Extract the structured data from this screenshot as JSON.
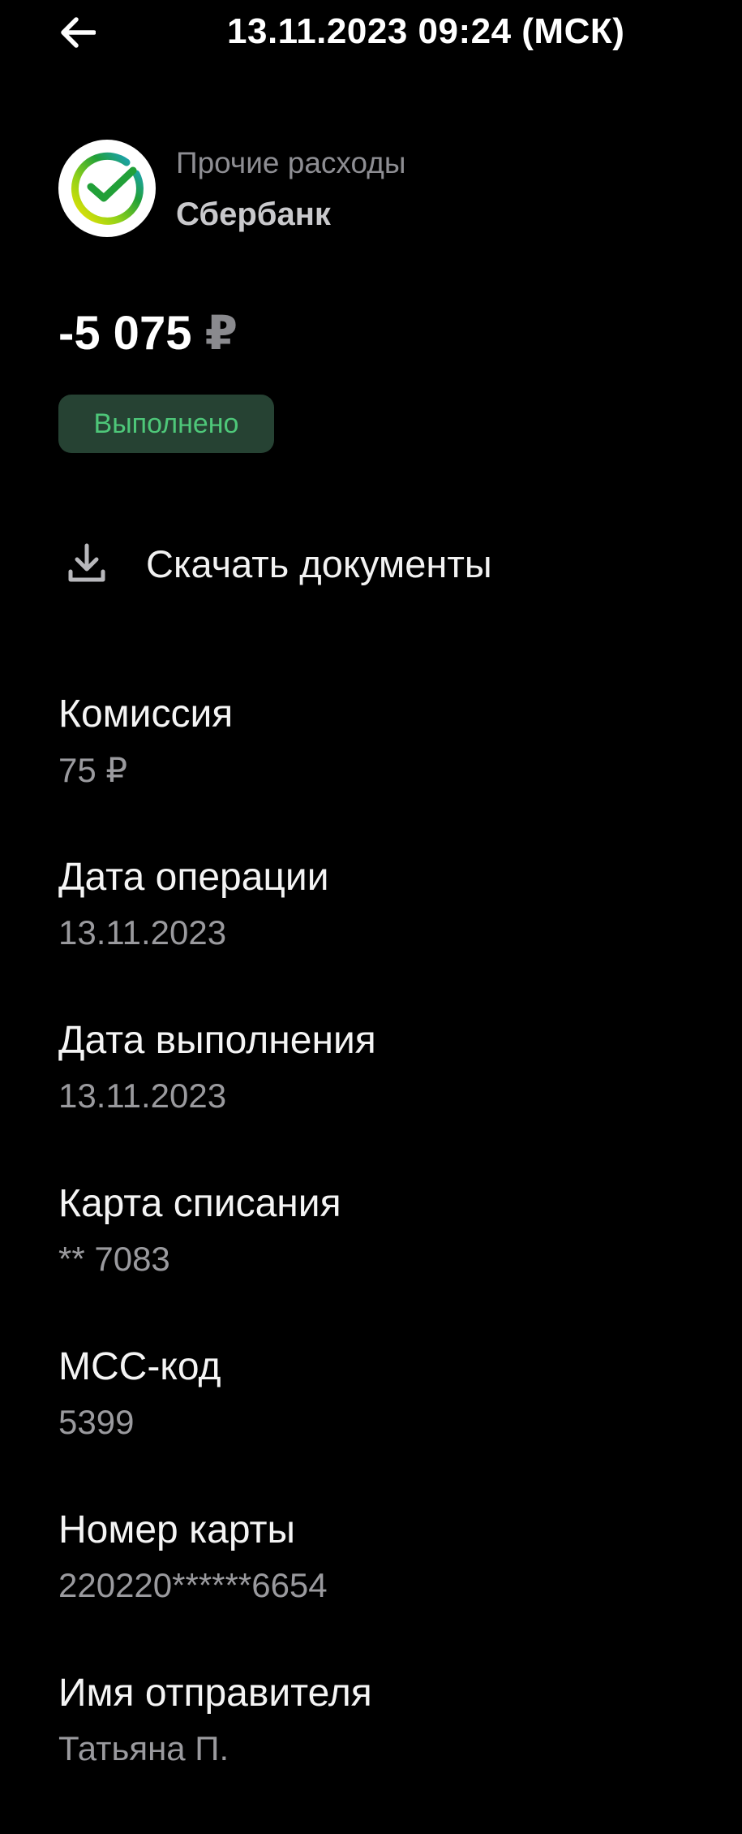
{
  "header": {
    "back_icon": "arrow-left-icon",
    "title": "13.11.2023 09:24 (МСК)"
  },
  "merchant": {
    "logo_icon": "sberbank-logo-icon",
    "category": "Прочие расходы",
    "name": "Сбербанк"
  },
  "transaction": {
    "amount": "-5 075",
    "currency": "₽",
    "status": "Выполнено"
  },
  "actions": {
    "download_icon": "download-icon",
    "download_label": "Скачать документы"
  },
  "details": [
    {
      "label": "Комиссия",
      "value": "75 ₽"
    },
    {
      "label": "Дата операции",
      "value": "13.11.2023"
    },
    {
      "label": "Дата выполнения",
      "value": "13.11.2023"
    },
    {
      "label": "Карта списания",
      "value": "** 7083"
    },
    {
      "label": "MCC-код",
      "value": "5399"
    },
    {
      "label": "Номер карты",
      "value": "220220******6654"
    },
    {
      "label": "Имя отправителя",
      "value": "Татьяна П."
    }
  ],
  "colors": {
    "background": "#000000",
    "status_badge_bg": "#264233",
    "status_text": "#4ec779",
    "secondary_text": "#9a9a9e"
  }
}
